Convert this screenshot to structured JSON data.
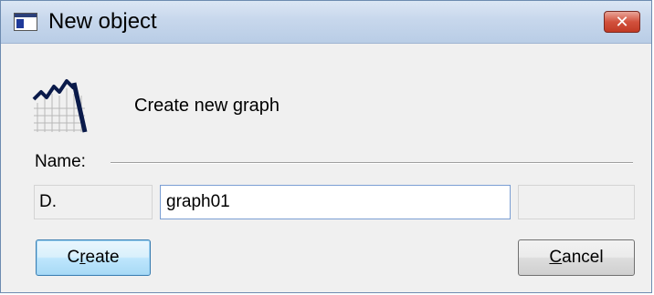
{
  "window": {
    "title": "New object",
    "close_glyph": "✕"
  },
  "header": {
    "icon": "graph-icon",
    "description": "Create new graph"
  },
  "form": {
    "name_label": "Name:",
    "prefix_value": "D.",
    "name_value": "graph01",
    "suffix_value": ""
  },
  "buttons": {
    "create_label": "Create",
    "create_mnemonic": "r",
    "cancel_label": "Cancel",
    "cancel_mnemonic": "C"
  },
  "colors": {
    "titlebar": "#c7d7ec",
    "close_button": "#c13a25",
    "default_button_border": "#3c7fb1",
    "icon_stroke": "#0a1a4a"
  }
}
